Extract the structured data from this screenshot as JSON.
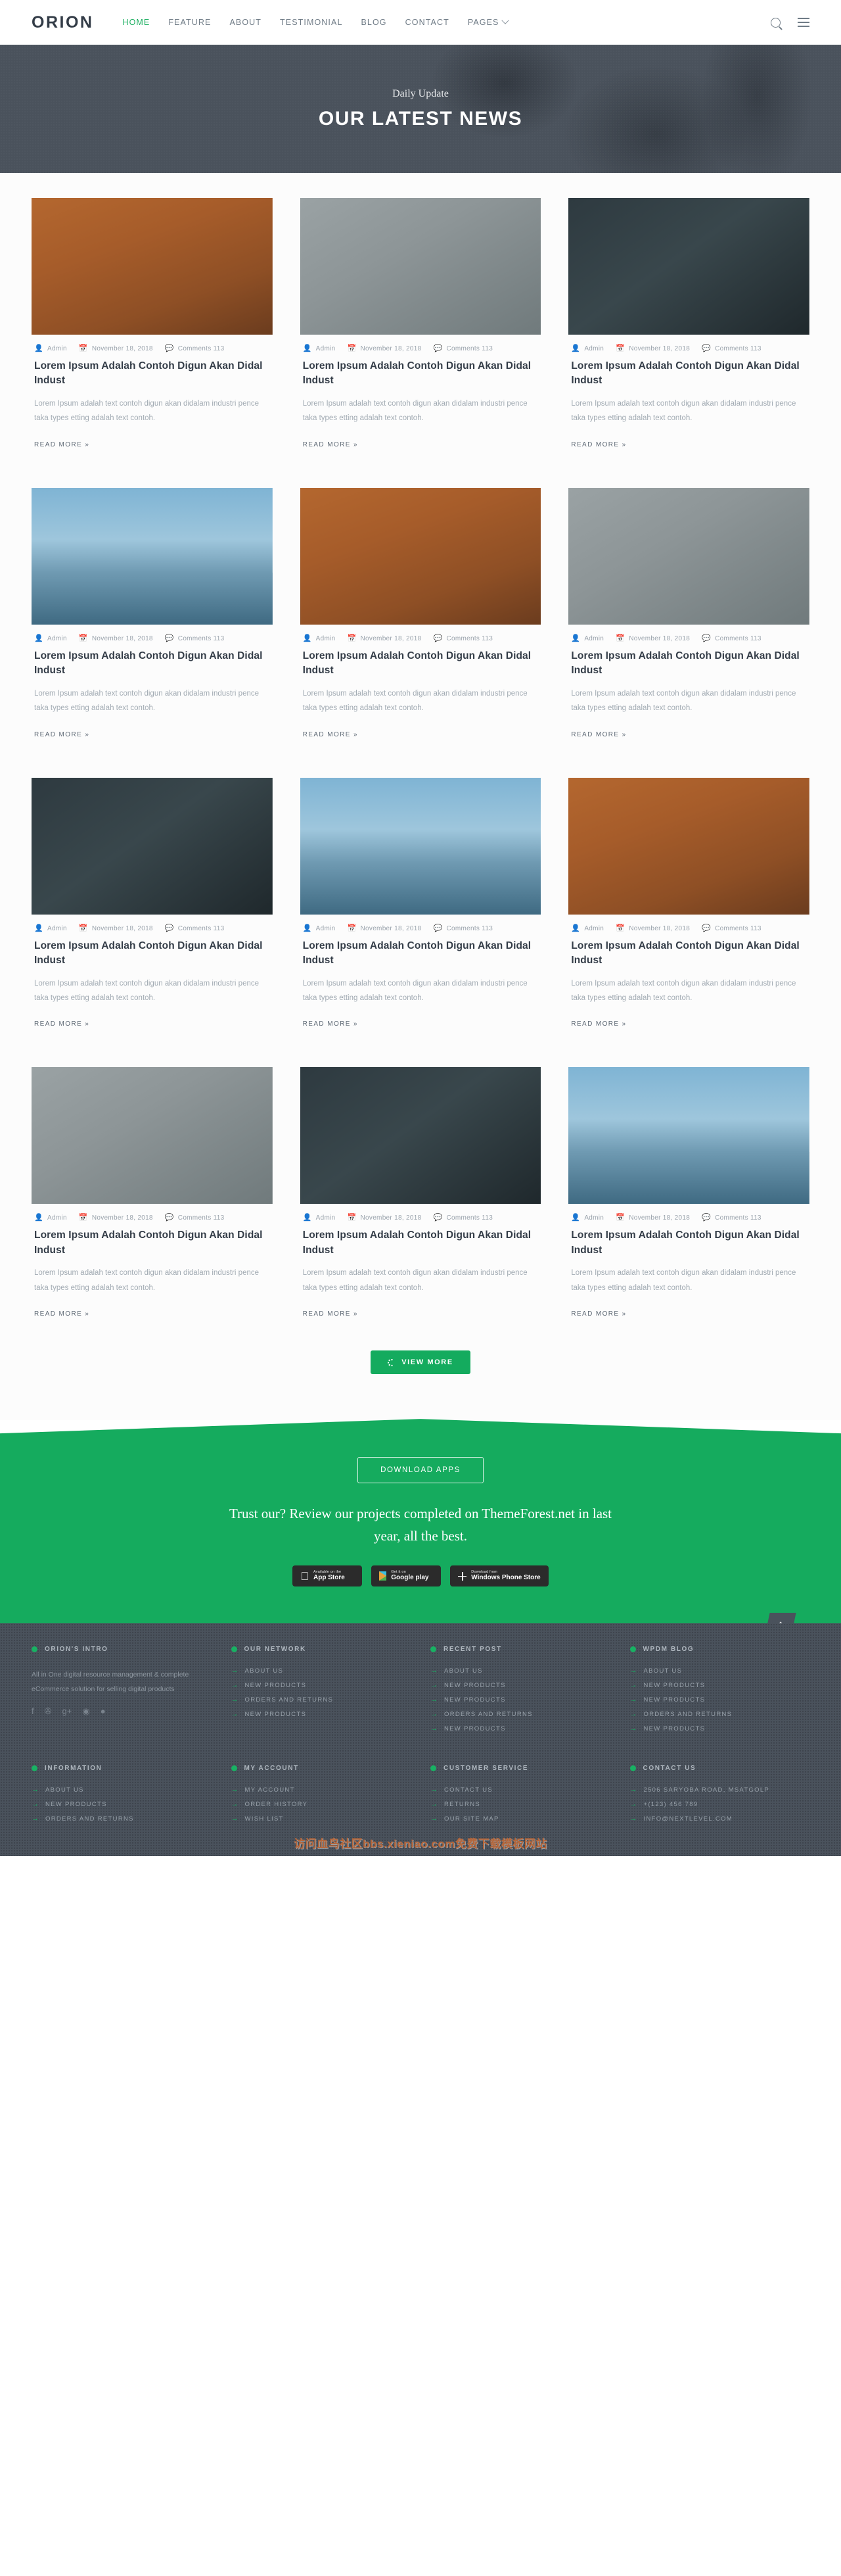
{
  "header": {
    "brand": "ORION",
    "nav": [
      {
        "label": "HOME",
        "active": true
      },
      {
        "label": "FEATURE",
        "active": false
      },
      {
        "label": "ABOUT",
        "active": false
      },
      {
        "label": "TESTIMONIAL",
        "active": false
      },
      {
        "label": "BLOG",
        "active": false
      },
      {
        "label": "CONTACT",
        "active": false
      },
      {
        "label": "PAGES",
        "active": false,
        "caret": true
      }
    ],
    "search_icon": "search-icon",
    "menu_icon": "hamburger-menu-icon"
  },
  "hero": {
    "subtitle": "Daily Update",
    "title": "OUR LATEST NEWS"
  },
  "post": {
    "author_label": "Admin",
    "date_label": "November 18, 2018",
    "comments_label": "Comments 113",
    "title": "Lorem Ipsum Adalah Contoh Digun Akan Didal Indust",
    "excerpt": "Lorem Ipsum adalah text contoh digun akan didalam industri pence taka types etting adalah text contoh.",
    "read_more": "READ MORE  »",
    "author_icon": "user-icon",
    "date_icon": "calendar-icon",
    "comments_icon": "comment-icon"
  },
  "posts": [
    {
      "image": "camera-sailboat-anchor"
    },
    {
      "image": "coffee-cup-lemon"
    },
    {
      "image": "gramophone-dog"
    },
    {
      "image": "woman-eiffel-tower"
    },
    {
      "image": "camera-sailboat-anchor"
    },
    {
      "image": "coffee-cup-lemon"
    },
    {
      "image": "gramophone-dog"
    },
    {
      "image": "woman-eiffel-tower"
    },
    {
      "image": "camera-sailboat-anchor"
    },
    {
      "image": "coffee-cup-lemon"
    },
    {
      "image": "gramophone-dog"
    },
    {
      "image": "woman-eiffel-tower"
    }
  ],
  "view_more": {
    "label": "VIEW MORE",
    "icon": "spinner-icon"
  },
  "cta": {
    "download_button": "DOWNLOAD APPS",
    "headline": "Trust our? Review our projects completed on ThemeForest.net in last year, all the best.",
    "badges": [
      {
        "icon": "apple-icon",
        "small": "Available on the",
        "big": "App Store"
      },
      {
        "icon": "google-play-icon",
        "small": "Get it on",
        "big": "Google play"
      },
      {
        "icon": "windows-icon",
        "small": "Download from",
        "big": "Windows Phone Store"
      }
    ],
    "scroll_top_icon": "arrow-up-icon"
  },
  "footer": {
    "columns_top": [
      {
        "title": "ORION'S INTRO",
        "text": "All in One digital resource management & complete eCommerce solution for selling digital products",
        "socials": [
          {
            "name": "facebook-icon",
            "glyph": "f"
          },
          {
            "name": "twitter-icon",
            "glyph": "✇"
          },
          {
            "name": "google-plus-icon",
            "glyph": "g+"
          },
          {
            "name": "dribbble-icon",
            "glyph": "◉"
          },
          {
            "name": "github-icon",
            "glyph": "●"
          }
        ]
      },
      {
        "title": "OUR NETWORK",
        "links": [
          "ABOUT US",
          "NEW PRODUCTS",
          "ORDERS AND RETURNS",
          "NEW PRODUCTS"
        ]
      },
      {
        "title": "RECENT POST",
        "links": [
          "ABOUT US",
          "NEW PRODUCTS",
          "NEW PRODUCTS",
          "ORDERS AND RETURNS",
          "NEW PRODUCTS"
        ]
      },
      {
        "title": "WPDM BLOG",
        "links": [
          "ABOUT US",
          "NEW PRODUCTS",
          "NEW PRODUCTS",
          "ORDERS AND RETURNS",
          "NEW PRODUCTS"
        ]
      }
    ],
    "columns_bottom": [
      {
        "title": "INFORMATION",
        "links": [
          "ABOUT US",
          "NEW PRODUCTS",
          "ORDERS AND RETURNS"
        ]
      },
      {
        "title": "MY ACCOUNT",
        "links": [
          "MY ACCOUNT",
          "ORDER HISTORY",
          "WISH LIST"
        ]
      },
      {
        "title": "CUSTOMER SERVICE",
        "links": [
          "CONTACT US",
          "RETURNS",
          "OUR SITE MAP"
        ]
      },
      {
        "title": "CONTACT US",
        "links": [
          "2506 SARYOBA ROAD, MSATGOLP",
          "+(123) 456 789",
          "INFO@NEXTLEVEL.COM"
        ]
      }
    ],
    "watermark": "访问血鸟社区bbs.xieniao.com免费下载模板网站"
  },
  "colors": {
    "accent_green": "#15ab5e",
    "dark_slate": "#4a525c",
    "heading": "#343d48",
    "muted": "#a2abb3"
  }
}
